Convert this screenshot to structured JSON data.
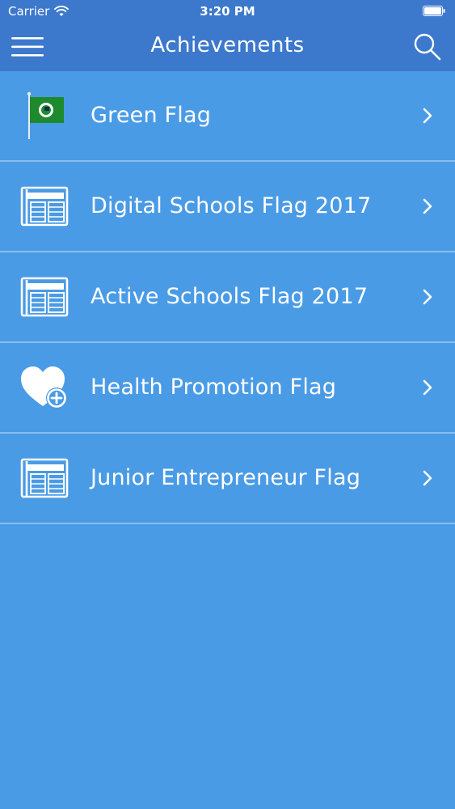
{
  "status_bar": {
    "carrier": "Carrier",
    "time": "3:20 PM"
  },
  "nav": {
    "title": "Achievements",
    "menu_icon": "hamburger-menu-icon",
    "search_icon": "search-icon"
  },
  "items": [
    {
      "label": "Green Flag",
      "icon": "green-flag-icon"
    },
    {
      "label": "Digital Schools Flag 2017",
      "icon": "newspaper-icon"
    },
    {
      "label": "Active Schools Flag 2017",
      "icon": "newspaper-icon"
    },
    {
      "label": "Health Promotion Flag",
      "icon": "heart-plus-icon"
    },
    {
      "label": "Junior Entrepreneur Flag",
      "icon": "newspaper-icon"
    }
  ],
  "colors": {
    "header": "#3c79cc",
    "background": "#4a9be6",
    "flag_green": "#1e8a2e"
  }
}
